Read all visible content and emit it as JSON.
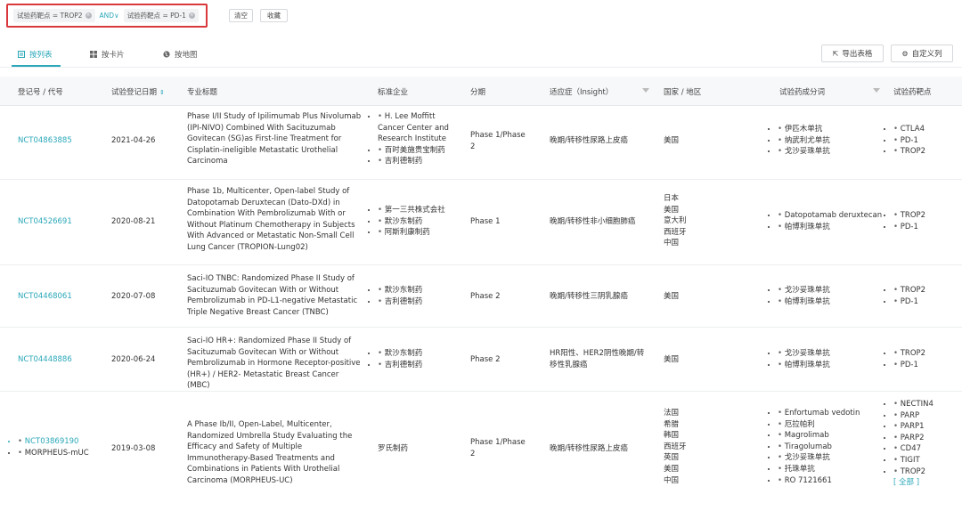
{
  "filters": {
    "chip1": {
      "label": "试验药靶点 = TROP2"
    },
    "operator": "AND∨",
    "chip2": {
      "label": "试验药靶点 = PD-1"
    },
    "clear_label": "清空",
    "save_label": "收藏"
  },
  "views": {
    "list": "按列表",
    "card": "按卡片",
    "map": "按地图"
  },
  "actions": {
    "export": "导出表格",
    "custom_columns": "自定义列"
  },
  "columns": {
    "reg_id": "登记号 / 代号",
    "reg_date": "试验登记日期",
    "title": "专业标题",
    "sponsor": "标准企业",
    "phase": "分期",
    "indication": "适应症（Insight）",
    "country": "国家 / 地区",
    "drug": "试验药成分词",
    "target": "试验药靶点"
  },
  "rows": [
    {
      "id": "NCT04863885",
      "date": "2021-04-26",
      "title": "Phase I/II Study of Ipilimumab Plus Nivolumab (IPI-NIVO) Combined With Sacituzumab Govitecan (SG)as First-line Treatment for Cisplatin-ineligible Metastatic Urothelial Carcinoma",
      "sponsors": [
        "H. Lee Moffitt Cancer Center and Research Institute",
        "百时美施贵宝制药",
        "吉利德制药"
      ],
      "phase": "Phase 1/Phase 2",
      "indication": "晚期/转移性尿路上皮癌",
      "countries": [
        "美国"
      ],
      "drugs": [
        "伊匹木单抗",
        "纳武利尤单抗",
        "戈沙妥珠单抗"
      ],
      "targets": [
        "CTLA4",
        "PD-1",
        "TROP2"
      ]
    },
    {
      "id": "NCT04526691",
      "date": "2020-08-21",
      "title": "Phase 1b, Multicenter, Open-label Study of Datopotamab Deruxtecan (Dato-DXd) in Combination With Pembrolizumab With or Without Platinum Chemotherapy in Subjects With Advanced or Metastatic Non-Small Cell Lung Cancer (TROPION-Lung02)",
      "sponsors": [
        "第一三共株式会社",
        "默沙东制药",
        "阿斯利康制药"
      ],
      "phase": "Phase 1",
      "indication": "晚期/转移性非小细胞肺癌",
      "countries": [
        "日本",
        "美国",
        "意大利",
        "西班牙",
        "中国"
      ],
      "drugs": [
        "Datopotamab deruxtecan",
        "帕博利珠单抗"
      ],
      "targets": [
        "TROP2",
        "PD-1"
      ]
    },
    {
      "id": "NCT04468061",
      "date": "2020-07-08",
      "title": "Saci-IO TNBC: Randomized Phase II Study of Sacituzumab Govitecan With or Without Pembrolizumab in PD-L1-negative Metastatic Triple Negative Breast Cancer (TNBC)",
      "sponsors": [
        "默沙东制药",
        "吉利德制药"
      ],
      "phase": "Phase 2",
      "indication": "晚期/转移性三阴乳腺癌",
      "countries": [
        "美国"
      ],
      "drugs": [
        "戈沙妥珠单抗",
        "帕博利珠单抗"
      ],
      "targets": [
        "TROP2",
        "PD-1"
      ]
    },
    {
      "id": "NCT04448886",
      "date": "2020-06-24",
      "title": "Saci-IO HR+: Randomized Phase II Study of Sacituzumab Govitecan With or Without Pembrolizumab in Hormone Receptor-positive (HR+) / HER2- Metastatic Breast Cancer (MBC)",
      "sponsors": [
        "默沙东制药",
        "吉利德制药"
      ],
      "phase": "Phase 2",
      "indication": "HR阳性、HER2阴性晚期/转移性乳腺癌",
      "countries": [
        "美国"
      ],
      "drugs": [
        "戈沙妥珠单抗",
        "帕博利珠单抗"
      ],
      "targets": [
        "TROP2",
        "PD-1"
      ]
    },
    {
      "id": "NCT03869190",
      "alias": "MORPHEUS-mUC",
      "date": "2019-03-08",
      "title": "A Phase Ib/II, Open-Label, Multicenter, Randomized Umbrella Study Evaluating the Efficacy and Safety of Multiple Immunotherapy-Based Treatments and Combinations in Patients With Urothelial Carcinoma (MORPHEUS-UC)",
      "sponsor_plain": "罗氏制药",
      "phase": "Phase 1/Phase 2",
      "indication": "晚期/转移性尿路上皮癌",
      "countries": [
        "法国",
        "希腊",
        "韩国",
        "西班牙",
        "英国",
        "美国",
        "中国"
      ],
      "drugs": [
        "Enfortumab vedotin",
        "厄拉帕利",
        "Magrolimab",
        "Tiragolumab",
        "戈沙妥珠单抗",
        "托珠单抗",
        "RO 7121661"
      ],
      "targets": [
        "NECTIN4",
        "PARP",
        "PARP1",
        "PARP2",
        "CD47",
        "TIGIT",
        "TROP2"
      ],
      "more": "[ 全部 ]"
    }
  ]
}
